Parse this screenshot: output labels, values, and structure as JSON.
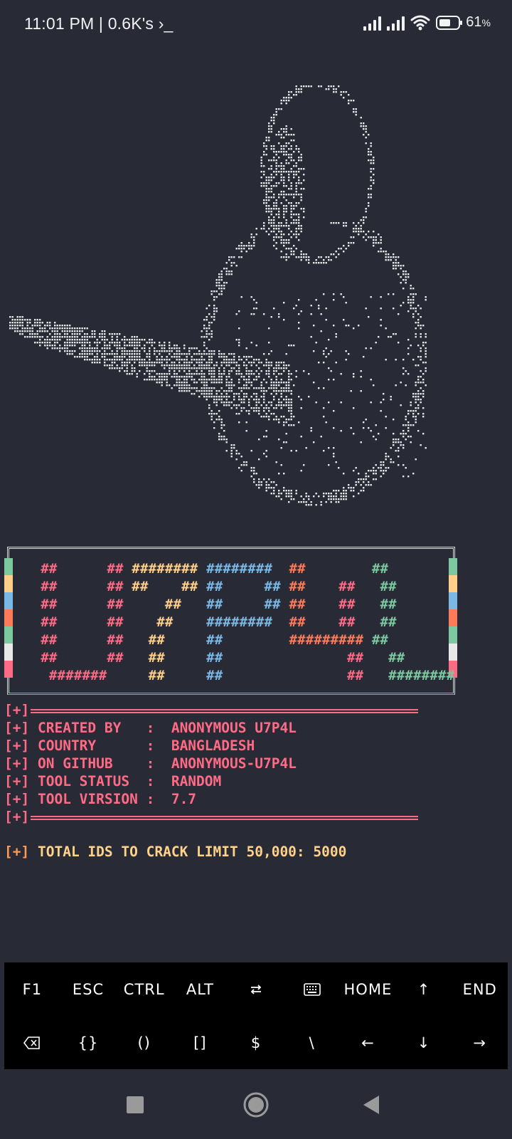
{
  "status_bar": {
    "time_text": "11:01 PM | 0.6K's",
    "prompt_glyph": "›_",
    "battery_text": "61",
    "battery_unit": "%",
    "battery_level": 0.61
  },
  "banner": {
    "letters": "U7P4L",
    "strip_colors": [
      "#7cc9a0",
      "#ffcf8a",
      "#7ab8e6",
      "#ff7a59",
      "#7cc9a0",
      "#e8e8e8",
      "#ff6b85"
    ],
    "rows": [
      [
        [
          "  ##      ##",
          "#ff6b85"
        ],
        [
          " ########",
          "#ffcf8a"
        ],
        [
          " ########",
          "#7ab8e6"
        ],
        [
          "  ##",
          "#ff7a59"
        ],
        [
          "        ##",
          "#7cc9a0"
        ]
      ],
      [
        [
          "  ##      ##",
          "#ff6b85"
        ],
        [
          " ##    ##",
          "#ffcf8a"
        ],
        [
          " ##     ##",
          "#7ab8e6"
        ],
        [
          " ##",
          "#ff7a59"
        ],
        [
          "    ##",
          "#ff6b85"
        ],
        [
          "   ##",
          "#7cc9a0"
        ]
      ],
      [
        [
          "  ##      ##",
          "#ff6b85"
        ],
        [
          "     ##",
          "#ffcf8a"
        ],
        [
          "   ##     ##",
          "#7ab8e6"
        ],
        [
          " ##",
          "#ff7a59"
        ],
        [
          "    ##",
          "#ff6b85"
        ],
        [
          "   ##",
          "#7cc9a0"
        ]
      ],
      [
        [
          "  ##      ##",
          "#ff6b85"
        ],
        [
          "    ##",
          "#ffcf8a"
        ],
        [
          "    ########",
          "#7ab8e6"
        ],
        [
          "  ##",
          "#ff7a59"
        ],
        [
          "    ##",
          "#ff6b85"
        ],
        [
          "   ##",
          "#7cc9a0"
        ]
      ],
      [
        [
          "  ##      ##",
          "#ff6b85"
        ],
        [
          "   ##",
          "#ffcf8a"
        ],
        [
          "     ##",
          "#7ab8e6"
        ],
        [
          "        #########",
          "#ff7a59"
        ],
        [
          " ##",
          "#7cc9a0"
        ]
      ],
      [
        [
          "  ##      ##",
          "#ff6b85"
        ],
        [
          "   ##",
          "#ffcf8a"
        ],
        [
          "     ##",
          "#7ab8e6"
        ],
        [
          "               ##",
          "#ff6b85"
        ],
        [
          "   ##",
          "#7cc9a0"
        ]
      ],
      [
        [
          "   #######",
          "#ff6b85"
        ],
        [
          "     ##",
          "#ffcf8a"
        ],
        [
          "     ##",
          "#7ab8e6"
        ],
        [
          "               ##",
          "#ff6b85"
        ],
        [
          "   ########",
          "#7cc9a0"
        ]
      ]
    ]
  },
  "info": {
    "prefix": "[+]",
    "lines": [
      "CREATED BY   :  ANONYMOUS U7P4L",
      "COUNTRY      :  BANGLADESH",
      "ON GITHUB    :  ANONYMOUS-U7P4L",
      "TOOL STATUS  :  RANDOM",
      "TOOL VIRSION :  7.7"
    ],
    "total_line": "TOTAL IDS TO CRACK LIMIT 50,000: 5000"
  },
  "extra_keys": {
    "row1": [
      {
        "label": "F1",
        "name": "key-f1"
      },
      {
        "label": "ESC",
        "name": "key-esc"
      },
      {
        "label": "CTRL",
        "name": "key-ctrl"
      },
      {
        "label": "ALT",
        "name": "key-alt"
      },
      {
        "label": "",
        "name": "key-tab",
        "icon": "tab-icon"
      },
      {
        "label": "",
        "name": "key-keyboard",
        "icon": "keyboard-icon"
      },
      {
        "label": "HOME",
        "name": "key-home"
      },
      {
        "label": "↑",
        "name": "key-up"
      },
      {
        "label": "END",
        "name": "key-end"
      }
    ],
    "row2": [
      {
        "label": "",
        "name": "key-backspace",
        "icon": "backspace-icon"
      },
      {
        "label": "{}",
        "name": "key-braces"
      },
      {
        "label": "()",
        "name": "key-parens"
      },
      {
        "label": "[]",
        "name": "key-brackets"
      },
      {
        "label": "$",
        "name": "key-dollar"
      },
      {
        "label": "\\",
        "name": "key-backslash"
      },
      {
        "label": "←",
        "name": "key-left"
      },
      {
        "label": "↓",
        "name": "key-down"
      },
      {
        "label": "→",
        "name": "key-right"
      }
    ]
  },
  "nav_bar": {
    "icons": [
      "recents-square-icon",
      "home-circle-icon",
      "back-triangle-icon"
    ]
  }
}
